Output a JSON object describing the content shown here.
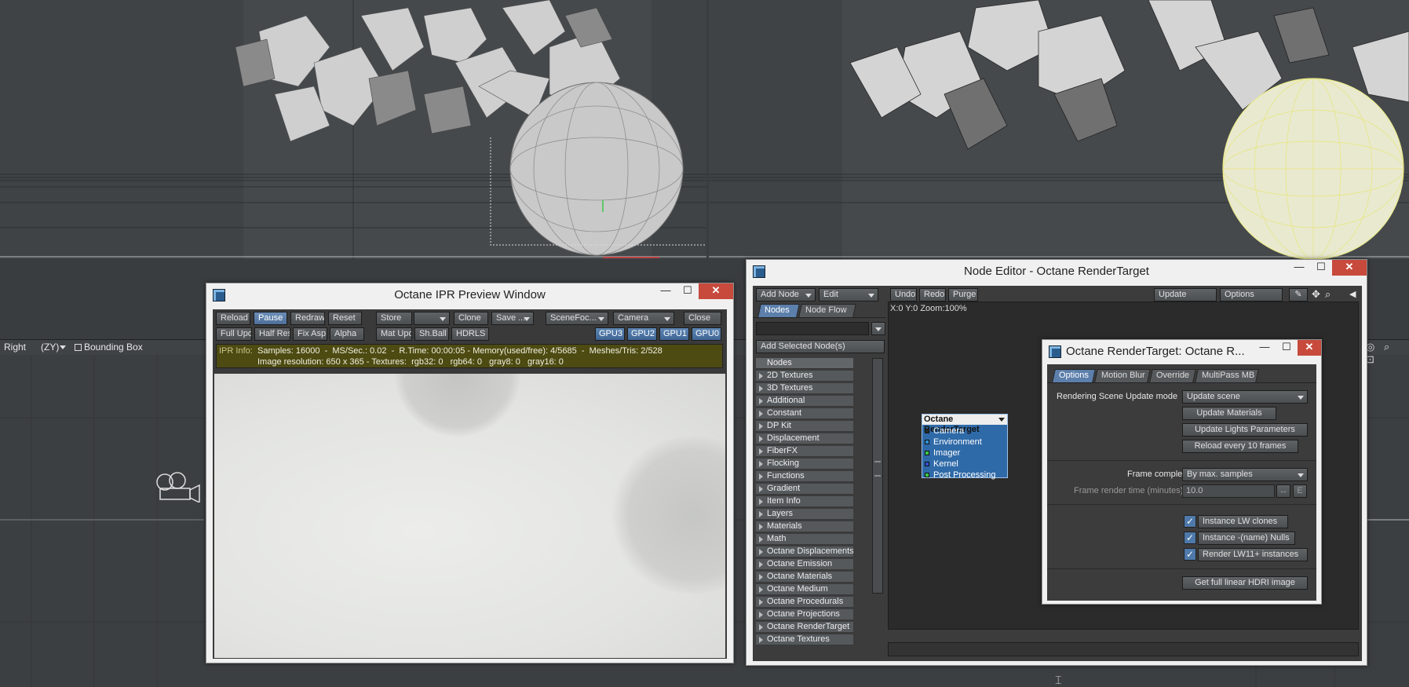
{
  "viewport": {
    "view_label": "Right",
    "axes": "(ZY)",
    "bounding_label": "Bounding Box"
  },
  "ipr": {
    "title": "Octane IPR Preview Window",
    "row1": [
      "Reload",
      "Pause",
      "Redraw",
      "Reset",
      "Store",
      "",
      "Clone",
      "Save ...",
      "SceneFoc...",
      "Camera",
      "Close"
    ],
    "row2": [
      "Full Upd.",
      "Half Res",
      "Fix Asp.",
      "Alpha",
      "Mat Upd",
      "Sh.Ball",
      "HDRLS"
    ],
    "gpus": [
      "GPU3",
      "GPU2",
      "GPU1",
      "GPU0"
    ],
    "info_label": "IPR Info:",
    "info_line1": "Samples: 16000  -  MS/Sec.: 0.02  -  R.Time: 00:00:05 - Memory(used/free): 4/5685  -  Meshes/Tris: 2/528",
    "info_line2": "Image resolution: 650 x 365 - Textures:  rgb32: 0   rgb64: 0   gray8: 0   gray16: 0"
  },
  "node_editor": {
    "title": "Node Editor - Octane RenderTarget",
    "menu": [
      "Add Node",
      "Edit",
      "Undo",
      "Redo",
      "Purge",
      "Update",
      "Options"
    ],
    "tabs": [
      "Nodes",
      "Node Flow"
    ],
    "coords": "X:0 Y:0 Zoom:100%",
    "add_selected": "Add Selected Node(s)",
    "tree_header": "Nodes",
    "tree_items": [
      "2D Textures",
      "3D Textures",
      "Additional",
      "Constant",
      "DP Kit",
      "Displacement",
      "FiberFX",
      "Flocking",
      "Functions",
      "Gradient",
      "Item Info",
      "Layers",
      "Materials",
      "Math",
      "Octane Displacements",
      "Octane Emission",
      "Octane Materials",
      "Octane Medium",
      "Octane Procedurals",
      "Octane Projections",
      "Octane RenderTarget",
      "Octane Textures"
    ],
    "node": {
      "title": "Octane RenderTarget",
      "ports": [
        {
          "label": "Camera",
          "color": "#2a2a2a"
        },
        {
          "label": "Environment",
          "color": "#2f8fd0"
        },
        {
          "label": "Imager",
          "color": "#3cc64a"
        },
        {
          "label": "Kernel",
          "color": "#2f4fd0"
        },
        {
          "label": "Post Processing",
          "color": "#3cc64a"
        }
      ]
    }
  },
  "rt_panel": {
    "title": "Octane RenderTarget: Octane R...",
    "tabs": [
      "Options",
      "Motion Blur",
      "Override",
      "MultiPass MB"
    ],
    "update_mode_label": "Rendering Scene Update mode",
    "update_mode_value": "Update scene",
    "btn_update_materials": "Update Materials",
    "btn_update_lights": "Update Lights Parameters",
    "btn_reload_every": "Reload every 10 frames",
    "frame_complete_label": "Frame complete",
    "frame_complete_value": "By max. samples",
    "frame_time_label": "Frame render time (minutes)",
    "frame_time_value": "10.0",
    "frame_time_btn": "E",
    "chk1": "Instance LW clones",
    "chk2": "Instance -(name) Nulls",
    "chk3": "Render LW11+ instances",
    "btn_hdri": "Get full linear HDRI image"
  }
}
